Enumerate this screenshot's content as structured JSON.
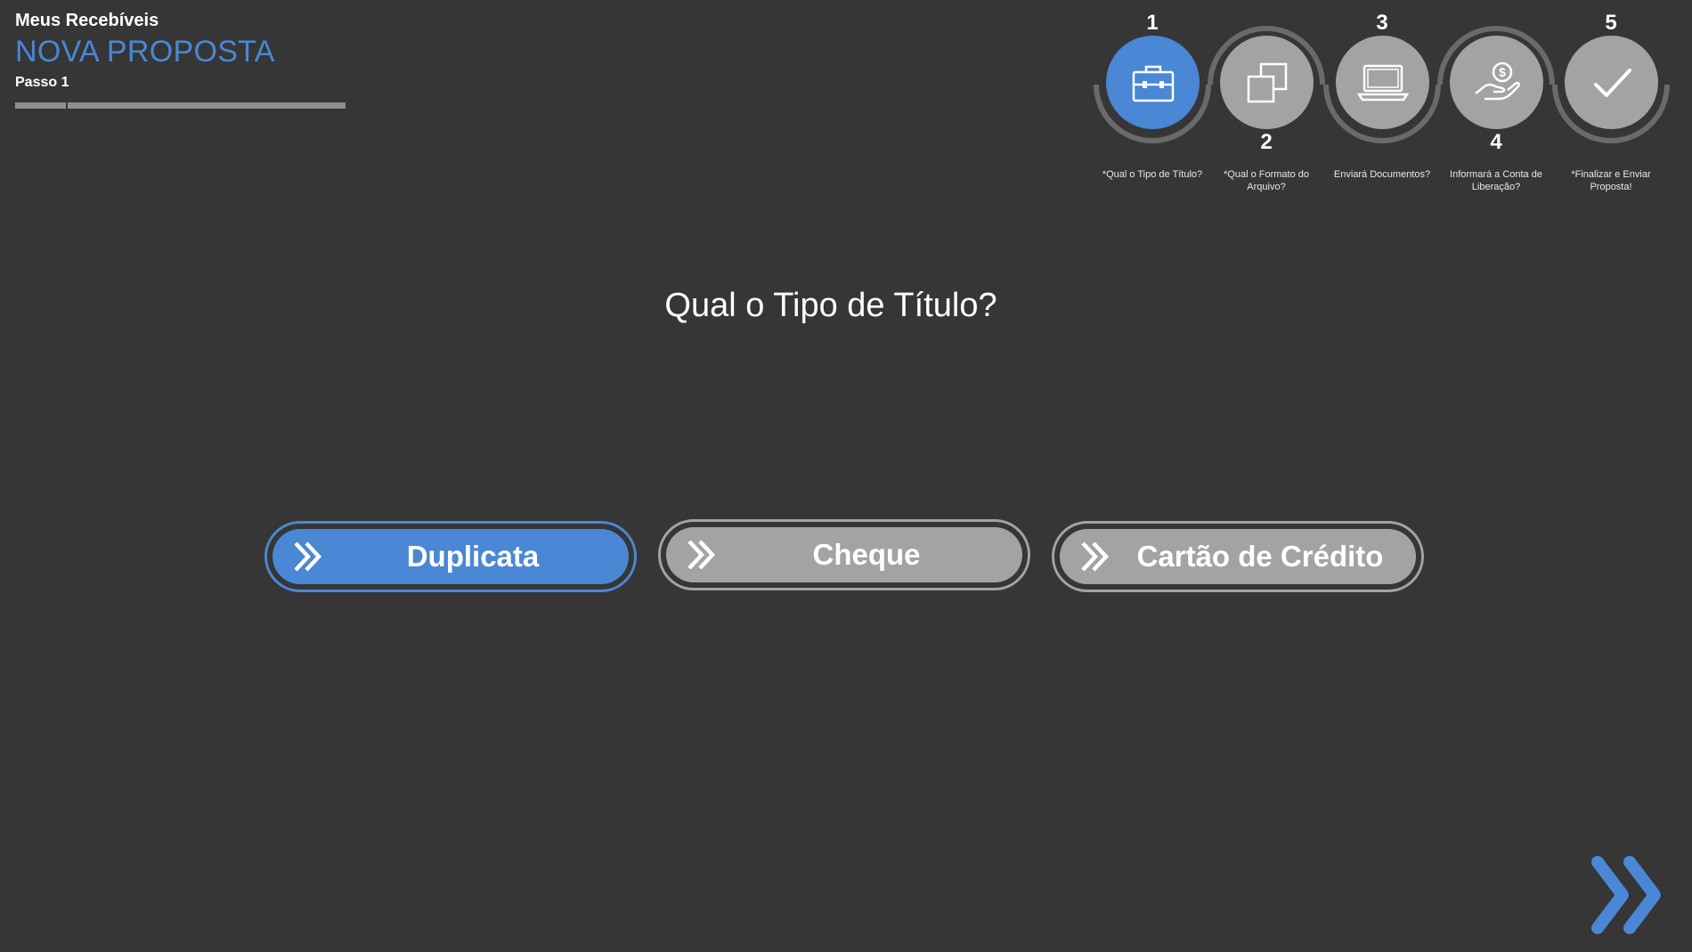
{
  "header": {
    "app_title": "Meus Recebíveis",
    "page_title": "NOVA PROPOSTA",
    "step_label": "Passo 1"
  },
  "stepper": {
    "steps": [
      {
        "number": "1",
        "icon": "briefcase-icon",
        "caption": "*Qual o Tipo de Título?",
        "active": true
      },
      {
        "number": "2",
        "icon": "copy-files-icon",
        "caption": "*Qual o Formato do Arquivo?",
        "active": false
      },
      {
        "number": "3",
        "icon": "laptop-icon",
        "caption": "Enviará Documentos?",
        "active": false
      },
      {
        "number": "4",
        "icon": "hand-money-icon",
        "caption": "Informará a Conta de Liberação?",
        "active": false
      },
      {
        "number": "5",
        "icon": "checkmark-icon",
        "caption": "*Finalizar e Enviar Proposta!",
        "active": false
      }
    ]
  },
  "main": {
    "question": "Qual o Tipo de Título?",
    "options": [
      {
        "label": "Duplicata",
        "selected": true
      },
      {
        "label": "Cheque",
        "selected": false
      },
      {
        "label": "Cartão de Crédito",
        "selected": false
      }
    ]
  },
  "colors": {
    "background": "#363636",
    "accent": "#4a87d4",
    "inactive": "#a3a3a3"
  },
  "icons": {
    "option_icon": "double-chevron-right-icon",
    "next": "double-chevron-right-icon"
  }
}
